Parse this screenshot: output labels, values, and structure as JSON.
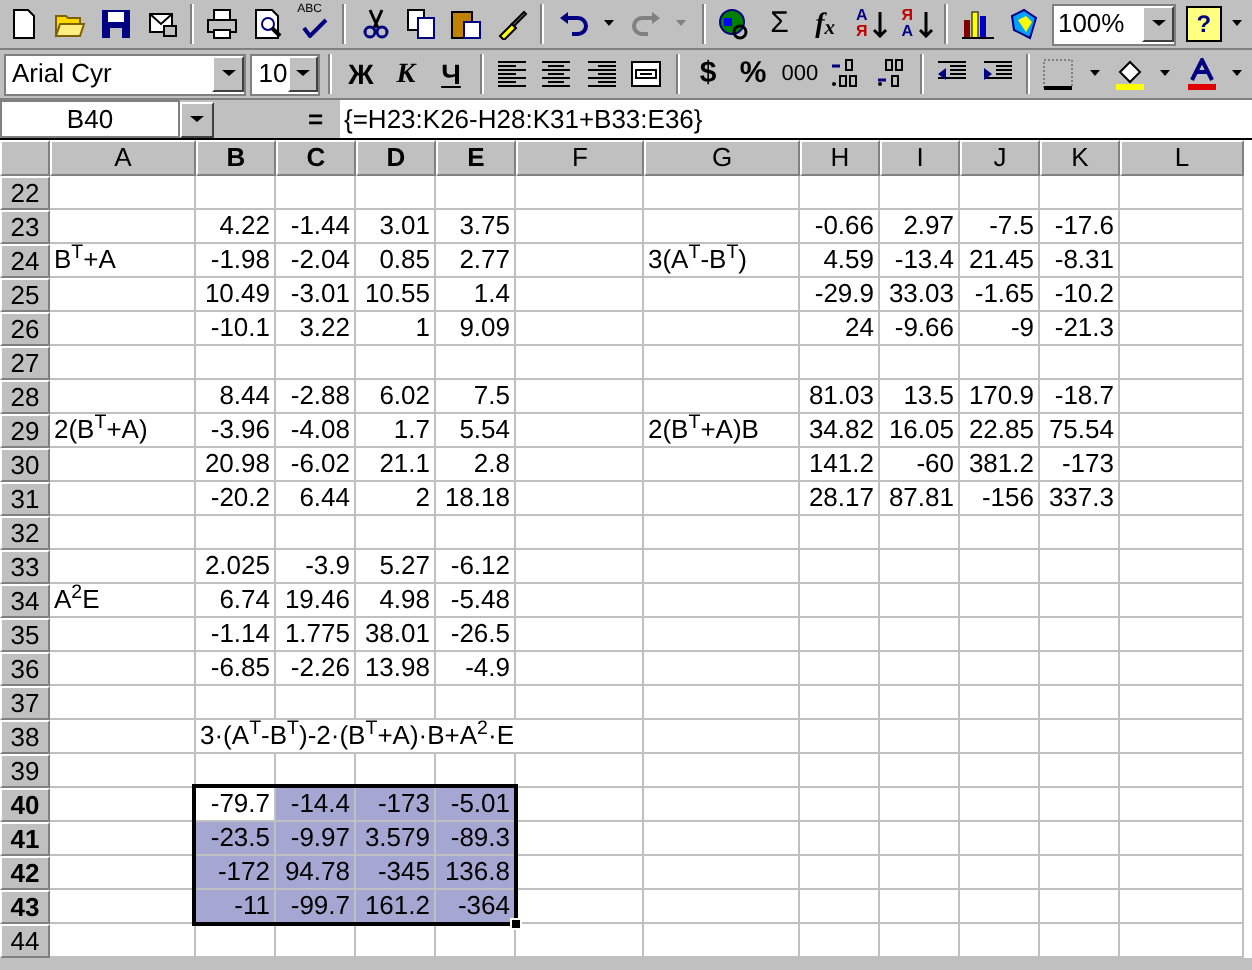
{
  "standard_toolbar": {
    "spelling": "ABC",
    "sum": "Σ",
    "function": "f$_{x}$",
    "sort_ascending": {
      "top": "A",
      "bottom": "Я"
    },
    "sort_descending": {
      "top": "Я",
      "bottom": "A"
    },
    "zoom": "100%",
    "help": "?"
  },
  "formatting_toolbar": {
    "font": "Arial Cyr",
    "size": "10",
    "bold": "Ж",
    "italic": "К",
    "underline": "Ч",
    "currency": "$",
    "percent": "%",
    "thousands": "000"
  },
  "formula_bar": {
    "name_box": "B40",
    "equals": "=",
    "formula": "{=H23:K26-H28:K31+B33:E36}"
  },
  "sheet": {
    "columns": [
      {
        "label": "A",
        "selected": false
      },
      {
        "label": "B",
        "selected": true
      },
      {
        "label": "C",
        "selected": true
      },
      {
        "label": "D",
        "selected": true
      },
      {
        "label": "E",
        "selected": true
      },
      {
        "label": "F",
        "selected": false
      },
      {
        "label": "G",
        "selected": false
      },
      {
        "label": "H",
        "selected": false
      },
      {
        "label": "I",
        "selected": false
      },
      {
        "label": "J",
        "selected": false
      },
      {
        "label": "K",
        "selected": false
      },
      {
        "label": "L",
        "selected": false
      }
    ],
    "rows": [
      {
        "number": "22",
        "selected": false,
        "cells": []
      },
      {
        "number": "23",
        "selected": false,
        "cells": [
          null,
          {
            "kind": "number",
            "text": "4.22"
          },
          {
            "kind": "number",
            "text": "-1.44"
          },
          {
            "kind": "number",
            "text": "3.01"
          },
          {
            "kind": "number",
            "text": "3.75"
          },
          null,
          null,
          {
            "kind": "number",
            "text": "-0.66"
          },
          {
            "kind": "number",
            "text": "2.97"
          },
          {
            "kind": "number",
            "text": "-7.5"
          },
          {
            "kind": "number",
            "text": "-17.6"
          }
        ]
      },
      {
        "number": "24",
        "selected": false,
        "cells": [
          {
            "kind": "label",
            "text": "B$^{T}$+A"
          },
          {
            "kind": "number",
            "text": "-1.98"
          },
          {
            "kind": "number",
            "text": "-2.04"
          },
          {
            "kind": "number",
            "text": "0.85"
          },
          {
            "kind": "number",
            "text": "2.77"
          },
          null,
          {
            "kind": "label",
            "text": "3(A$^{T}$-B$^{T}$)"
          },
          {
            "kind": "number",
            "text": "4.59"
          },
          {
            "kind": "number",
            "text": "-13.4"
          },
          {
            "kind": "number",
            "text": "21.45"
          },
          {
            "kind": "number",
            "text": "-8.31"
          }
        ]
      },
      {
        "number": "25",
        "selected": false,
        "cells": [
          null,
          {
            "kind": "number",
            "text": "10.49"
          },
          {
            "kind": "number",
            "text": "-3.01"
          },
          {
            "kind": "number",
            "text": "10.55"
          },
          {
            "kind": "number",
            "text": "1.4"
          },
          null,
          null,
          {
            "kind": "number",
            "text": "-29.9"
          },
          {
            "kind": "number",
            "text": "33.03"
          },
          {
            "kind": "number",
            "text": "-1.65"
          },
          {
            "kind": "number",
            "text": "-10.2"
          }
        ]
      },
      {
        "number": "26",
        "selected": false,
        "cells": [
          null,
          {
            "kind": "number",
            "text": "-10.1"
          },
          {
            "kind": "number",
            "text": "3.22"
          },
          {
            "kind": "number",
            "text": "1"
          },
          {
            "kind": "number",
            "text": "9.09"
          },
          null,
          null,
          {
            "kind": "number",
            "text": "24"
          },
          {
            "kind": "number",
            "text": "-9.66"
          },
          {
            "kind": "number",
            "text": "-9"
          },
          {
            "kind": "number",
            "text": "-21.3"
          }
        ]
      },
      {
        "number": "27",
        "selected": false,
        "cells": []
      },
      {
        "number": "28",
        "selected": false,
        "cells": [
          null,
          {
            "kind": "number",
            "text": "8.44"
          },
          {
            "kind": "number",
            "text": "-2.88"
          },
          {
            "kind": "number",
            "text": "6.02"
          },
          {
            "kind": "number",
            "text": "7.5"
          },
          null,
          null,
          {
            "kind": "number",
            "text": "81.03"
          },
          {
            "kind": "number",
            "text": "13.5"
          },
          {
            "kind": "number",
            "text": "170.9"
          },
          {
            "kind": "number",
            "text": "-18.7"
          }
        ]
      },
      {
        "number": "29",
        "selected": false,
        "cells": [
          {
            "kind": "label",
            "text": "2(B$^{T}$+A)"
          },
          {
            "kind": "number",
            "text": "-3.96"
          },
          {
            "kind": "number",
            "text": "-4.08"
          },
          {
            "kind": "number",
            "text": "1.7"
          },
          {
            "kind": "number",
            "text": "5.54"
          },
          null,
          {
            "kind": "label",
            "text": "2(B$^{T}$+A)B"
          },
          {
            "kind": "number",
            "text": "34.82"
          },
          {
            "kind": "number",
            "text": "16.05"
          },
          {
            "kind": "number",
            "text": "22.85"
          },
          {
            "kind": "number",
            "text": "75.54"
          }
        ]
      },
      {
        "number": "30",
        "selected": false,
        "cells": [
          null,
          {
            "kind": "number",
            "text": "20.98"
          },
          {
            "kind": "number",
            "text": "-6.02"
          },
          {
            "kind": "number",
            "text": "21.1"
          },
          {
            "kind": "number",
            "text": "2.8"
          },
          null,
          null,
          {
            "kind": "number",
            "text": "141.2"
          },
          {
            "kind": "number",
            "text": "-60"
          },
          {
            "kind": "number",
            "text": "381.2"
          },
          {
            "kind": "number",
            "text": "-173"
          }
        ]
      },
      {
        "number": "31",
        "selected": false,
        "cells": [
          null,
          {
            "kind": "number",
            "text": "-20.2"
          },
          {
            "kind": "number",
            "text": "6.44"
          },
          {
            "kind": "number",
            "text": "2"
          },
          {
            "kind": "number",
            "text": "18.18"
          },
          null,
          null,
          {
            "kind": "number",
            "text": "28.17"
          },
          {
            "kind": "number",
            "text": "87.81"
          },
          {
            "kind": "number",
            "text": "-156"
          },
          {
            "kind": "number",
            "text": "337.3"
          }
        ]
      },
      {
        "number": "32",
        "selected": false,
        "cells": []
      },
      {
        "number": "33",
        "selected": false,
        "cells": [
          null,
          {
            "kind": "number",
            "text": "2.025"
          },
          {
            "kind": "number",
            "text": "-3.9"
          },
          {
            "kind": "number",
            "text": "5.27"
          },
          {
            "kind": "number",
            "text": "-6.12"
          }
        ]
      },
      {
        "number": "34",
        "selected": false,
        "cells": [
          {
            "kind": "label",
            "text": "A$^{2}$E"
          },
          {
            "kind": "number",
            "text": "6.74"
          },
          {
            "kind": "number",
            "text": "19.46"
          },
          {
            "kind": "number",
            "text": "4.98"
          },
          {
            "kind": "number",
            "text": "-5.48"
          }
        ]
      },
      {
        "number": "35",
        "selected": false,
        "cells": [
          null,
          {
            "kind": "number",
            "text": "-1.14"
          },
          {
            "kind": "number",
            "text": "1.775"
          },
          {
            "kind": "number",
            "text": "38.01"
          },
          {
            "kind": "number",
            "text": "-26.5"
          }
        ]
      },
      {
        "number": "36",
        "selected": false,
        "cells": [
          null,
          {
            "kind": "number",
            "text": "-6.85"
          },
          {
            "kind": "number",
            "text": "-2.26"
          },
          {
            "kind": "number",
            "text": "13.98"
          },
          {
            "kind": "number",
            "text": "-4.9"
          }
        ]
      },
      {
        "number": "37",
        "selected": false,
        "cells": []
      },
      {
        "number": "38",
        "selected": false,
        "cells": [
          null,
          {
            "kind": "label",
            "text": "3·(A$^{T}$-B$^{T}$)-2·(B$^{T}$+A)·B+A$^{2}$·E"
          }
        ]
      },
      {
        "number": "39",
        "selected": false,
        "cells": []
      },
      {
        "number": "40",
        "selected": true,
        "cells": [
          null,
          {
            "kind": "number",
            "text": "-79.7"
          },
          {
            "kind": "number",
            "text": "-14.4"
          },
          {
            "kind": "number",
            "text": "-173"
          },
          {
            "kind": "number",
            "text": "-5.01"
          }
        ]
      },
      {
        "number": "41",
        "selected": true,
        "cells": [
          null,
          {
            "kind": "number",
            "text": "-23.5"
          },
          {
            "kind": "number",
            "text": "-9.97"
          },
          {
            "kind": "number",
            "text": "3.579"
          },
          {
            "kind": "number",
            "text": "-89.3"
          }
        ]
      },
      {
        "number": "42",
        "selected": true,
        "cells": [
          null,
          {
            "kind": "number",
            "text": "-172"
          },
          {
            "kind": "number",
            "text": "94.78"
          },
          {
            "kind": "number",
            "text": "-345"
          },
          {
            "kind": "number",
            "text": "136.8"
          }
        ]
      },
      {
        "number": "43",
        "selected": true,
        "cells": [
          null,
          {
            "kind": "number",
            "text": "-11"
          },
          {
            "kind": "number",
            "text": "-99.7"
          },
          {
            "kind": "number",
            "text": "161.2"
          },
          {
            "kind": "number",
            "text": "-364"
          }
        ]
      },
      {
        "number": "44",
        "selected": false,
        "cells": []
      }
    ]
  }
}
